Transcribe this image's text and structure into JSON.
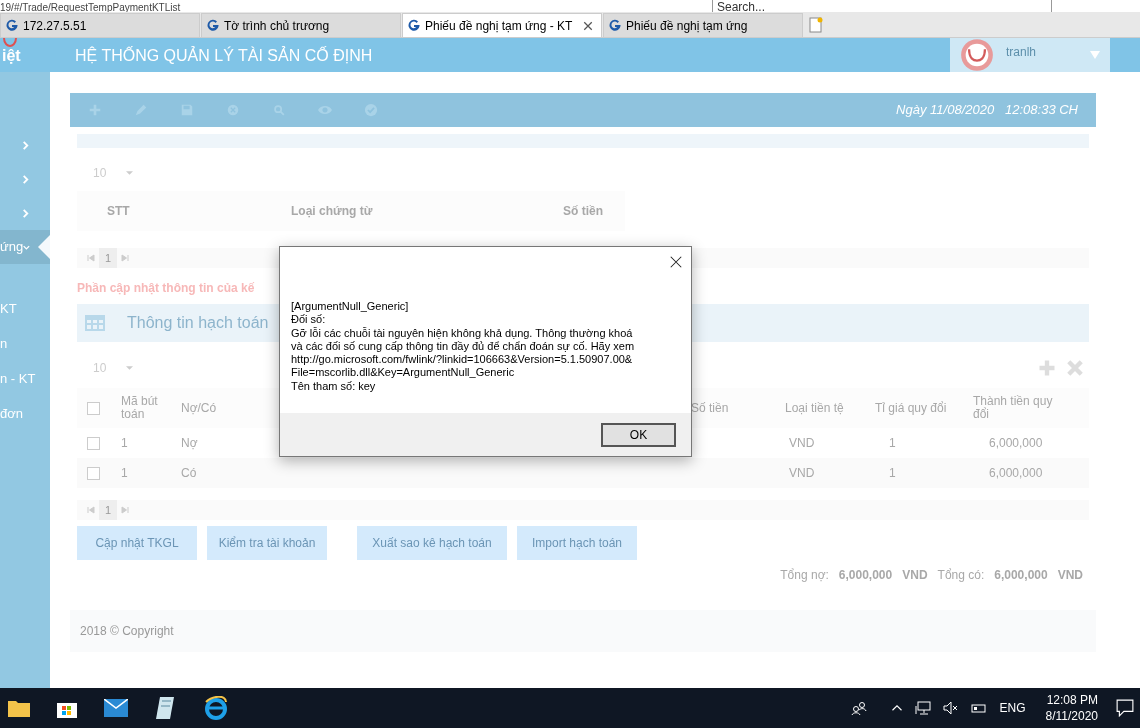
{
  "browser": {
    "address": "19/#/Trade/RequestTempPaymentKTList",
    "search_placeholder": "Search...",
    "tabs": [
      {
        "label": "172.27.5.51",
        "selected": false
      },
      {
        "label": "Tờ trình chủ trương",
        "selected": false
      },
      {
        "label": "Phiếu đề nghị tạm ứng - KT",
        "selected": true
      },
      {
        "label": "Phiếu đề nghị tạm ứng",
        "selected": false
      }
    ]
  },
  "header": {
    "logo_text": "iệt",
    "title": "HỆ THỐNG QUẢN LÝ TÀI SẢN CỐ ĐỊNH",
    "user": "tranlh"
  },
  "sidebar": {
    "items": [
      {
        "expanded": false,
        "selected": false
      },
      {
        "expanded": false,
        "selected": false
      },
      {
        "expanded": false,
        "selected": false
      },
      {
        "label": "ứng",
        "expanded": true,
        "selected": true,
        "children": [
          {
            "label": "KT"
          },
          {
            "label": "n"
          },
          {
            "label": "n - KT"
          },
          {
            "label": "đơn"
          }
        ]
      }
    ]
  },
  "toolbar": {
    "date": "Ngày 11/08/2020",
    "time": "12:08:33 CH"
  },
  "documents": {
    "page_size": "10",
    "columns": [
      "STT",
      "Loại chứng từ",
      "Số tiền"
    ],
    "page": "1"
  },
  "update_note": "Phần cập nhật thông tin của kế",
  "accounting": {
    "title": "Thông tin hạch toán",
    "page_size": "10",
    "select_all_checked": false,
    "columns": [
      "Mã bút toán",
      "Nợ/Có",
      "Số tiền",
      "Loại tiền tệ",
      "Tỉ giá quy đổi",
      "Thành tiền quy đổi"
    ],
    "rows": [
      {
        "checked": false,
        "code": "1",
        "side": "Nợ",
        "currency": "VND",
        "rate": "1",
        "converted": "6,000,000"
      },
      {
        "checked": false,
        "code": "1",
        "side": "Có",
        "currency": "VND",
        "rate": "1",
        "converted": "6,000,000"
      }
    ],
    "page": "1"
  },
  "actions": [
    "Cập nhật TKGL",
    "Kiểm tra tài khoản",
    "Xuất sao kê hạch toán",
    "Import hạch toán"
  ],
  "totals": {
    "debit_label": "Tổng nợ:",
    "debit": "6,000,000",
    "debit_currency": "VND",
    "credit_label": "Tổng có:",
    "credit": "6,000,000",
    "credit_currency": "VND"
  },
  "footer": "2018 © Copyright",
  "dialog": {
    "lines": [
      "[ArgumentNull_Generic]",
      "Đối số:",
      "Gỡ lỗi các chuỗi tài nguyên hiện không khả dụng. Thông thường khoá",
      "và các đối số cung cấp thông tin đầy đủ để chẩn đoán sự cố. Hãy xem",
      "http://go.microsoft.com/fwlink/?linkid=106663&Version=5.1.50907.00&",
      "File=mscorlib.dll&Key=ArgumentNull_Generic",
      "Tên tham số: key"
    ],
    "button": "OK"
  },
  "taskbar": {
    "language": "ENG",
    "time": "12:08 PM",
    "date": "8/11/2020"
  }
}
